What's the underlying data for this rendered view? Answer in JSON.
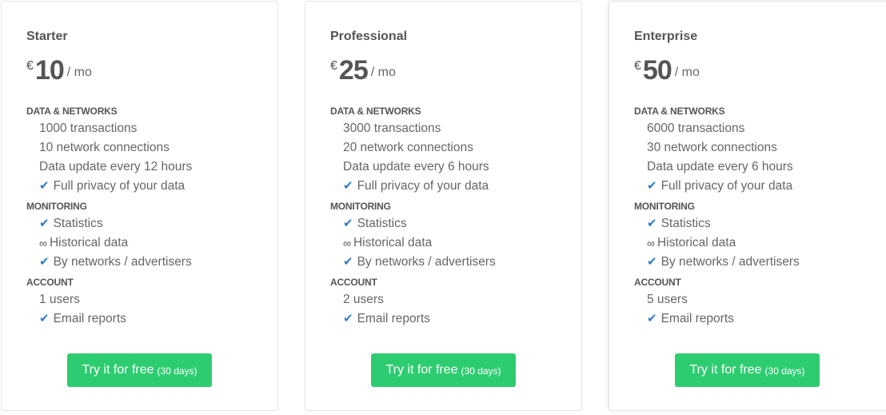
{
  "plans": [
    {
      "name": "Starter",
      "currency": "€",
      "amount": "10",
      "period": "/ mo",
      "sections": [
        {
          "title": "DATA & NETWORKS",
          "items": [
            {
              "icon": "none",
              "text": "1000 transactions"
            },
            {
              "icon": "none",
              "text": "10 network connections"
            },
            {
              "icon": "none",
              "text": "Data update every 12 hours"
            },
            {
              "icon": "check-icon",
              "text": "Full privacy of your data"
            }
          ]
        },
        {
          "title": "MONITORING",
          "items": [
            {
              "icon": "check-icon",
              "text": "Statistics"
            },
            {
              "icon": "infinity-icon",
              "text": "Historical data"
            },
            {
              "icon": "check-icon",
              "text": "By networks / advertisers"
            }
          ]
        },
        {
          "title": "ACCOUNT",
          "items": [
            {
              "icon": "none",
              "text": "1 users"
            },
            {
              "icon": "check-icon",
              "text": "Email reports"
            }
          ]
        }
      ],
      "button_label": "Try it for free",
      "button_note": "(30 days)"
    },
    {
      "name": "Professional",
      "currency": "€",
      "amount": "25",
      "period": "/ mo",
      "sections": [
        {
          "title": "DATA & NETWORKS",
          "items": [
            {
              "icon": "none",
              "text": "3000 transactions"
            },
            {
              "icon": "none",
              "text": "20 network connections"
            },
            {
              "icon": "none",
              "text": "Data update every 6 hours"
            },
            {
              "icon": "check-icon",
              "text": "Full privacy of your data"
            }
          ]
        },
        {
          "title": "MONITORING",
          "items": [
            {
              "icon": "check-icon",
              "text": "Statistics"
            },
            {
              "icon": "infinity-icon",
              "text": "Historical data"
            },
            {
              "icon": "check-icon",
              "text": "By networks / advertisers"
            }
          ]
        },
        {
          "title": "ACCOUNT",
          "items": [
            {
              "icon": "none",
              "text": "2 users"
            },
            {
              "icon": "check-icon",
              "text": "Email reports"
            }
          ]
        }
      ],
      "button_label": "Try it for free",
      "button_note": "(30 days)"
    },
    {
      "name": "Enterprise",
      "currency": "€",
      "amount": "50",
      "period": "/ mo",
      "sections": [
        {
          "title": "DATA & NETWORKS",
          "items": [
            {
              "icon": "none",
              "text": "6000 transactions"
            },
            {
              "icon": "none",
              "text": "30 network connections"
            },
            {
              "icon": "none",
              "text": "Data update every 6 hours"
            },
            {
              "icon": "check-icon",
              "text": "Full privacy of your data"
            }
          ]
        },
        {
          "title": "MONITORING",
          "items": [
            {
              "icon": "check-icon",
              "text": "Statistics"
            },
            {
              "icon": "infinity-icon",
              "text": "Historical data"
            },
            {
              "icon": "check-icon",
              "text": "By networks / advertisers"
            }
          ]
        },
        {
          "title": "ACCOUNT",
          "items": [
            {
              "icon": "none",
              "text": "5 users"
            },
            {
              "icon": "check-icon",
              "text": "Email reports"
            }
          ]
        }
      ],
      "button_label": "Try it for free",
      "button_note": "(30 days)"
    }
  ],
  "icons": {
    "check-icon": "✔",
    "infinity-icon": "∞"
  },
  "colors": {
    "button_green": "#2ecc71",
    "check_blue": "#2f7dc8"
  }
}
